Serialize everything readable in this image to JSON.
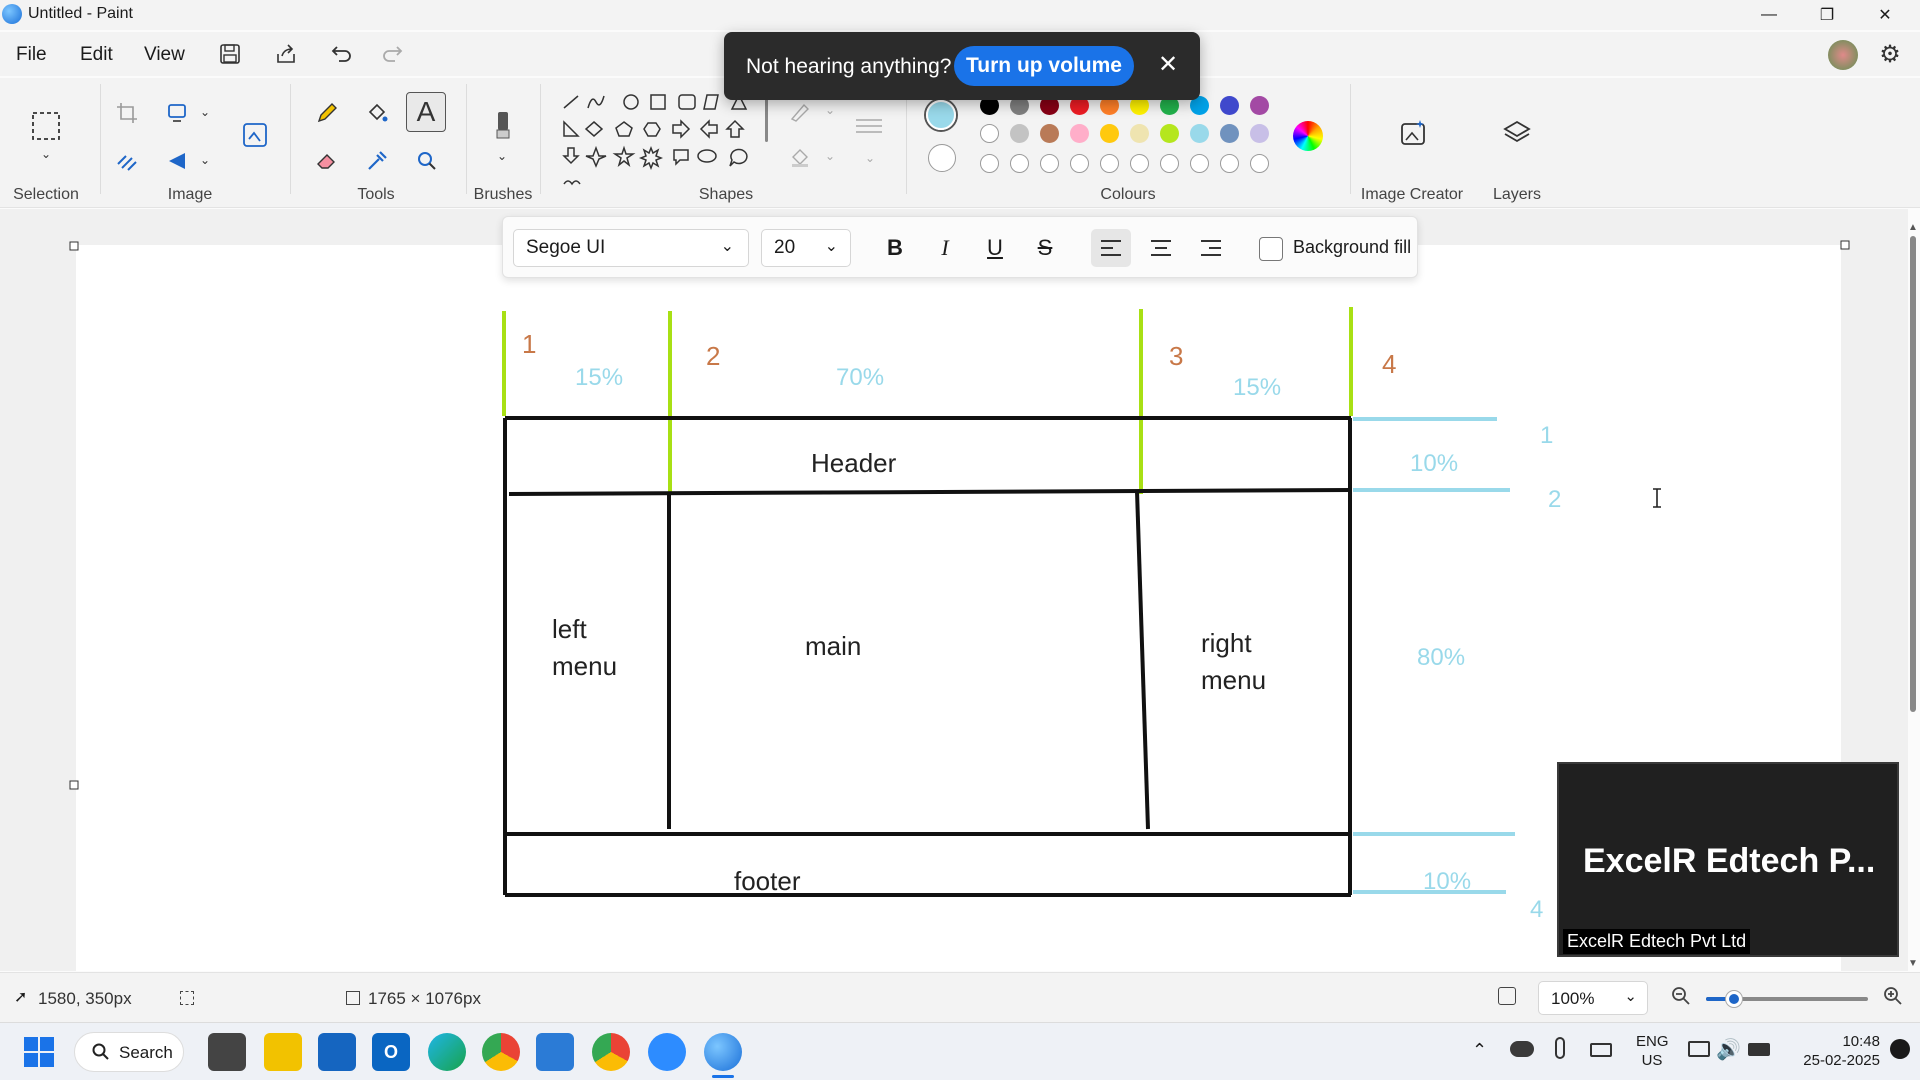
{
  "window": {
    "title": "Untitled - Paint",
    "controls": [
      "—",
      "❐",
      "✕"
    ]
  },
  "menu": [
    "File",
    "Edit",
    "View"
  ],
  "ribbon": {
    "groups": [
      "Selection",
      "Image",
      "Tools",
      "Brushes",
      "Shapes",
      "Colours",
      "Image Creator",
      "Layers"
    ],
    "palette_row1": [
      "#000000",
      "#7f7f7f",
      "#880015",
      "#ed1c24",
      "#ff7f27",
      "#fff200",
      "#22b14c",
      "#00a2e8",
      "#3f48cc",
      "#a349a4"
    ],
    "palette_row2": [
      "#ffffff",
      "#c3c3c3",
      "#b97a57",
      "#ffaec9",
      "#ffc90e",
      "#efe4b0",
      "#b5e61d",
      "#99d9ea",
      "#7092be",
      "#c8bfe7"
    ],
    "primary_color": "#99d9ea",
    "secondary_color": "#ffffff"
  },
  "toast": {
    "message": "Not hearing anything?",
    "button": "Turn up volume",
    "close": "✕"
  },
  "text_toolbar": {
    "font": "Segoe UI",
    "size": "20",
    "bold": "B",
    "italic": "I",
    "underline": "U",
    "strike": "S",
    "background_fill": "Background fill"
  },
  "canvas_drawing": {
    "column_numbers": [
      "1",
      "2",
      "3",
      "4"
    ],
    "column_percents": [
      "15%",
      "70%",
      "15%"
    ],
    "row_numbers": [
      "1",
      "2",
      "4"
    ],
    "row_percents": [
      "10%",
      "80%",
      "10%"
    ],
    "layout_labels": {
      "header": "Header",
      "left_menu_1": "left",
      "left_menu_2": "menu",
      "main": "main",
      "right_menu_1": "right",
      "right_menu_2": "menu",
      "footer": "footer"
    }
  },
  "video_overlay": {
    "display_name": "ExcelR Edtech P...",
    "label": "ExcelR Edtech Pvt Ltd"
  },
  "status": {
    "cursor_position": "1580, 350px",
    "canvas_size": "1765 × 1076px",
    "zoom": "100%"
  },
  "taskbar": {
    "search": "Search",
    "lang_1": "ENG",
    "lang_2": "US",
    "time": "10:48",
    "date": "25-02-2025"
  }
}
